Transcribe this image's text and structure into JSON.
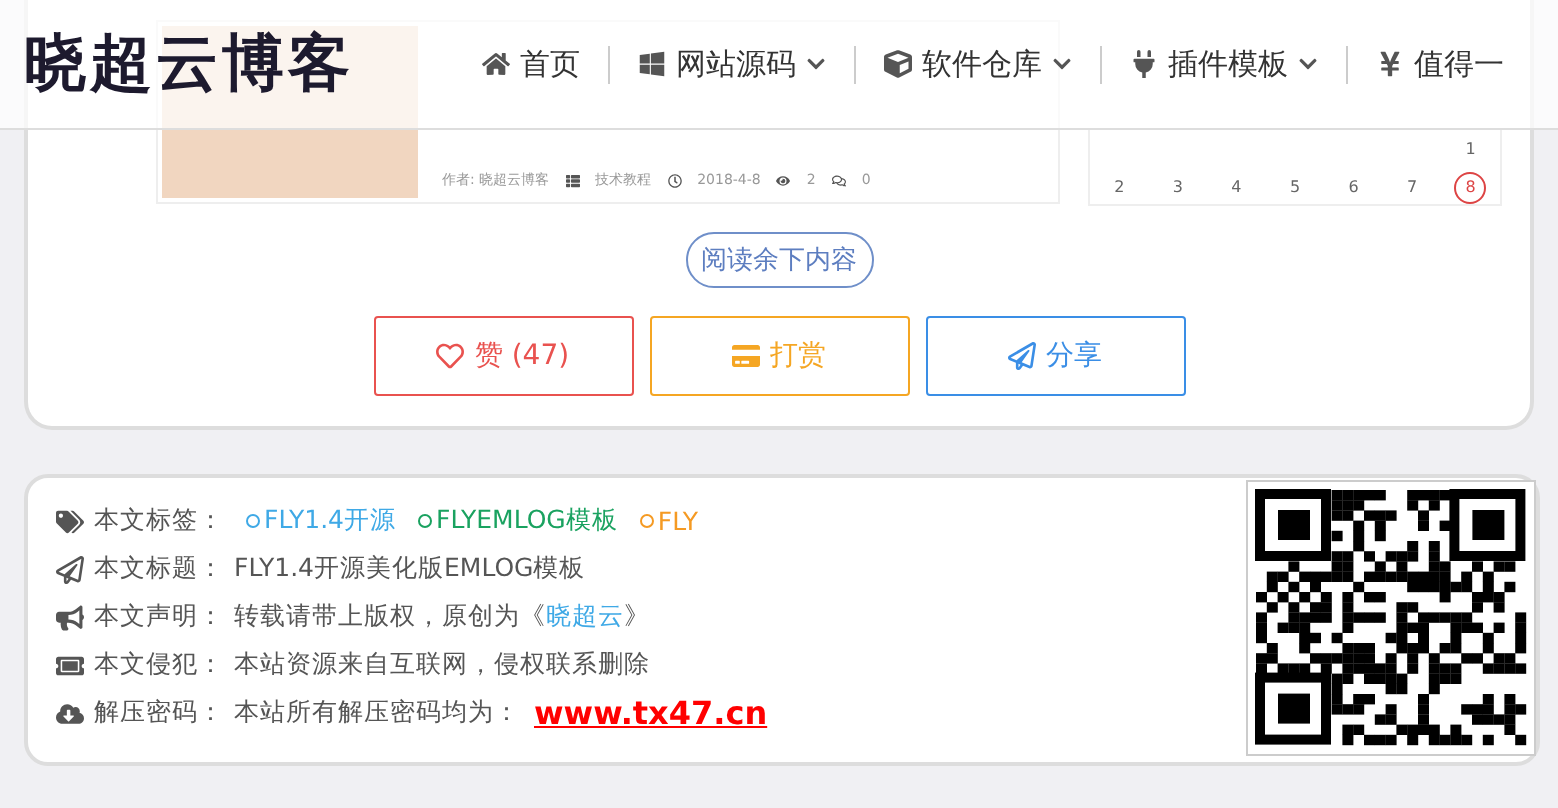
{
  "header": {
    "logo": "晓超云博客",
    "nav": [
      {
        "label": "首页",
        "dropdown": false
      },
      {
        "label": "网站源码",
        "dropdown": true
      },
      {
        "label": "软件仓库",
        "dropdown": true
      },
      {
        "label": "插件模板",
        "dropdown": true
      },
      {
        "label": "值得一",
        "dropdown": false
      }
    ]
  },
  "article": {
    "author": "作者: 晓超云博客",
    "category": "技术教程",
    "date": "2018-4-8",
    "views": "2",
    "comments": "0"
  },
  "calendar": {
    "rows": [
      [
        null,
        null,
        null,
        null,
        null,
        null,
        {
          "day": "1",
          "selected": false
        }
      ],
      [
        {
          "day": "2",
          "selected": false
        },
        {
          "day": "3",
          "selected": false
        },
        {
          "day": "4",
          "selected": false
        },
        {
          "day": "5",
          "selected": false
        },
        {
          "day": "6",
          "selected": false
        },
        {
          "day": "7",
          "selected": false
        },
        {
          "day": "8",
          "selected": true
        }
      ]
    ]
  },
  "read_more": "阅读余下内容",
  "actions": [
    {
      "kind": "like",
      "label": "赞 (47)",
      "color": "#e9524f"
    },
    {
      "kind": "reward",
      "label": "打赏",
      "color": "#f5a623"
    },
    {
      "kind": "share",
      "label": "分享",
      "color": "#3a8ee6"
    }
  ],
  "info": [
    {
      "kind": "tags",
      "label": "本文标签：",
      "tags": [
        {
          "text": "FLY1.4开源",
          "color": "#3fa9e6"
        },
        {
          "text": "FLYEMLOG模板",
          "color": "#1aa260"
        },
        {
          "text": "FLY",
          "color": "#f59a23"
        }
      ]
    },
    {
      "kind": "text",
      "label": "本文标题：",
      "text": "FLY1.4开源美化版EMLOG模板"
    },
    {
      "kind": "link",
      "label": "本文声明：",
      "text": "转载请带上版权，原创为《",
      "link": "晓超云",
      "after": "》"
    },
    {
      "kind": "text",
      "label": "本文侵犯：",
      "text": "本站资源来自互联网，侵权联系删除"
    },
    {
      "kind": "password",
      "label": "解压密码：",
      "text": "本站所有解压密码均为：",
      "value": "www.tx47.cn"
    }
  ]
}
